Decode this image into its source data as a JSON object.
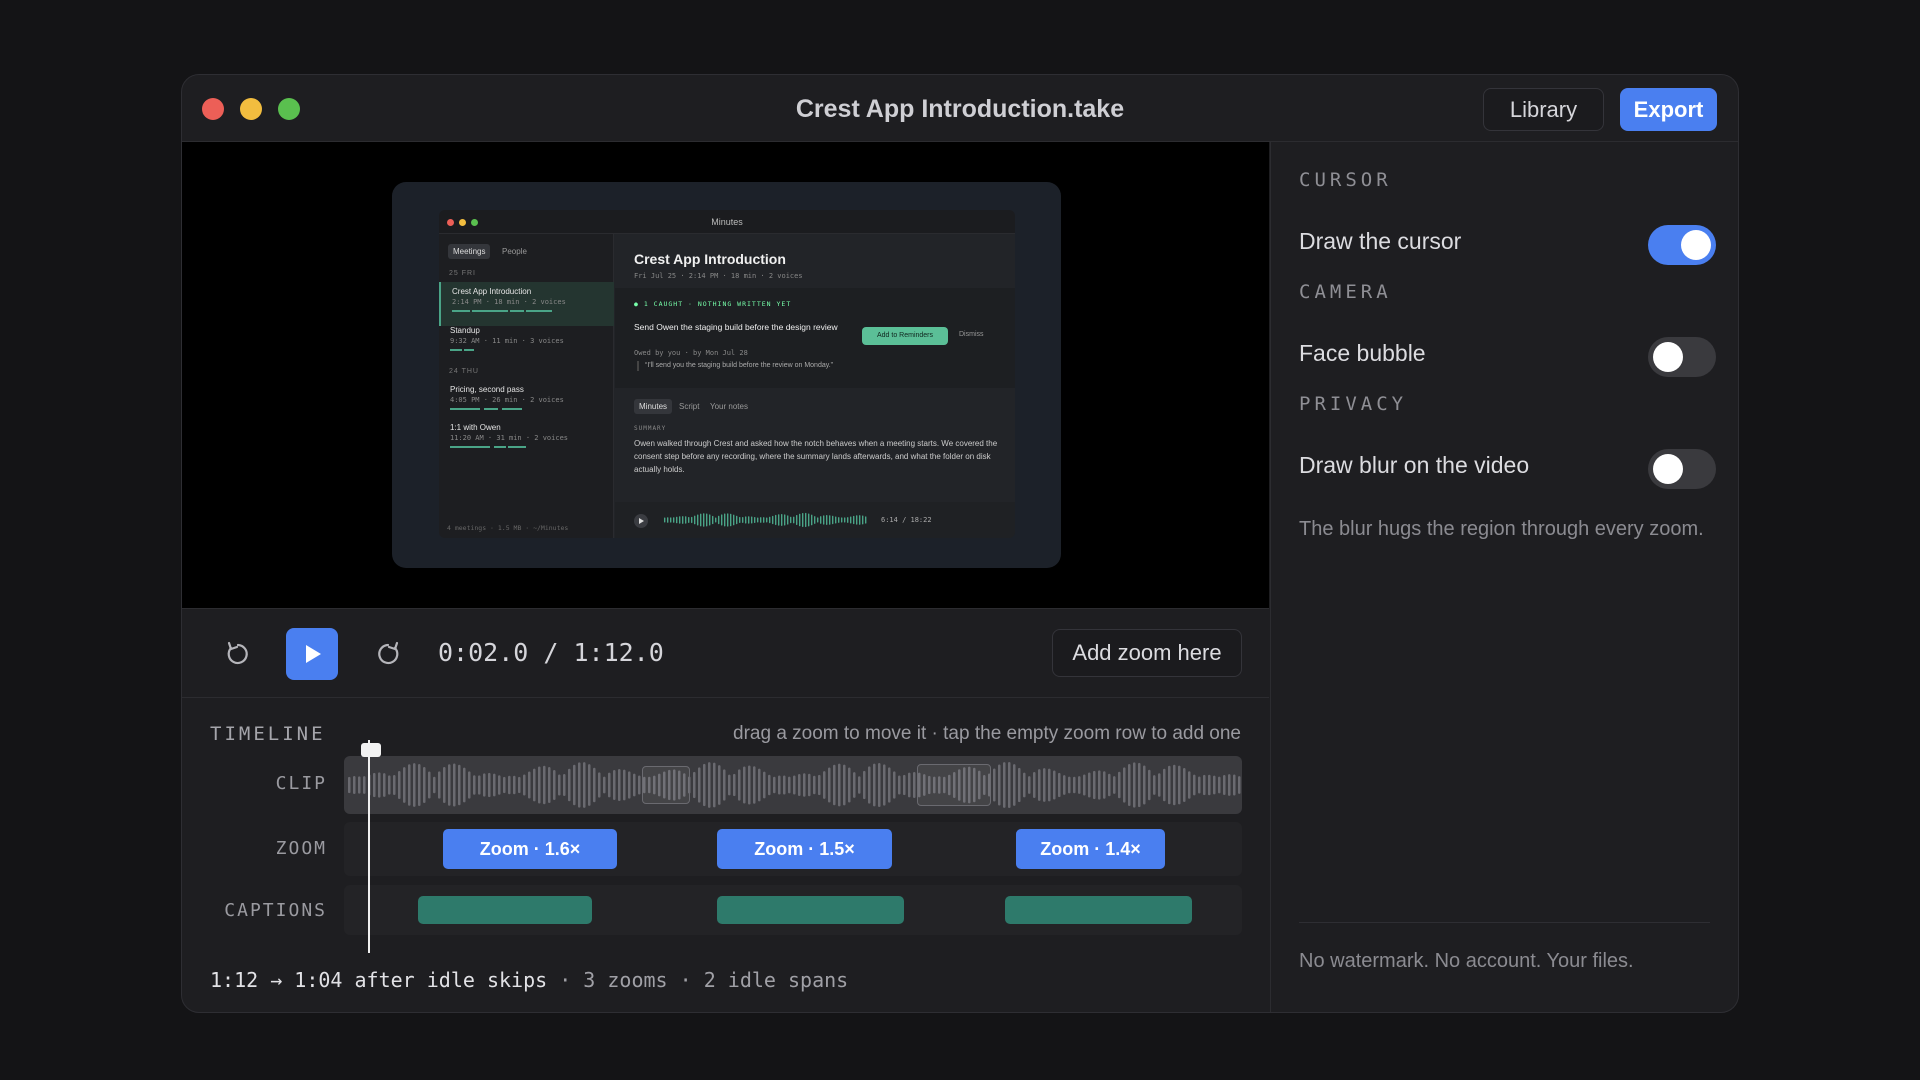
{
  "window": {
    "title": "Crest App Introduction.take",
    "library_label": "Library",
    "export_label": "Export"
  },
  "preview": {
    "app_title": "Minutes",
    "side_tabs": [
      "Meetings",
      "People"
    ],
    "day1": "25 FRI",
    "day2": "24 THU",
    "meetings": [
      {
        "title": "Crest App Introduction",
        "meta": "2:14 PM · 18 min · 2 voices"
      },
      {
        "title": "Standup",
        "meta": "9:32 AM · 11 min · 3 voices"
      },
      {
        "title": "Pricing, second pass",
        "meta": "4:05 PM · 26 min · 2 voices"
      },
      {
        "title": "1:1 with Owen",
        "meta": "11:20 AM · 31 min · 2 voices"
      }
    ],
    "footer": "4 meetings · 1.5 MB · ~/Minutes",
    "heading": "Crest App Introduction",
    "heading_meta": "Fri Jul 25 · 2:14 PM · 18 min · 2 voices",
    "caught": "● 1 CAUGHT · NOTHING WRITTEN YET",
    "task": "Send Owen the staging build before the design review",
    "owed": "Owed by you · by Mon Jul 28",
    "quote": "“I'll send you the staging build before the review on Monday.”",
    "add_reminders": "Add to Reminders",
    "dismiss": "Dismiss",
    "content_tabs": [
      "Minutes",
      "Script",
      "Your notes"
    ],
    "summary_label": "SUMMARY",
    "summary": "Owen walked through Crest and asked how the notch behaves when a meeting starts. We covered the consent step before any recording, where the summary lands afterwards, and what the folder on disk actually holds.",
    "player_time": "6:14 / 18:22"
  },
  "controls": {
    "timecode": "0:02.0 / 1:12.0",
    "add_zoom_label": "Add zoom here"
  },
  "timeline": {
    "heading": "TIMELINE",
    "hint": "drag a zoom to move it · tap the empty zoom row to add one",
    "rows": {
      "clip": "CLIP",
      "zoom": "ZOOM",
      "captions": "CAPTIONS"
    },
    "zooms": [
      "Zoom · 1.6×",
      "Zoom · 1.5×",
      "Zoom · 1.4×"
    ],
    "summary_main": "1:12 → 1:04 after idle skips",
    "summary_rest": "· 3 zooms · 2 idle spans"
  },
  "panel": {
    "cursor_heading": "CURSOR",
    "draw_cursor": "Draw the cursor",
    "draw_cursor_on": true,
    "camera_heading": "CAMERA",
    "face_bubble": "Face bubble",
    "face_bubble_on": false,
    "privacy_heading": "PRIVACY",
    "draw_blur": "Draw blur on the video",
    "draw_blur_on": false,
    "note": "The blur hugs the region through every zoom.",
    "footer": "No watermark. No account. Your files."
  },
  "colors": {
    "accent": "#4a7ff0",
    "caption": "#2e7a6b",
    "close": "#ec5f57",
    "minimize": "#f2bd3f",
    "maximize": "#5ac04f"
  }
}
